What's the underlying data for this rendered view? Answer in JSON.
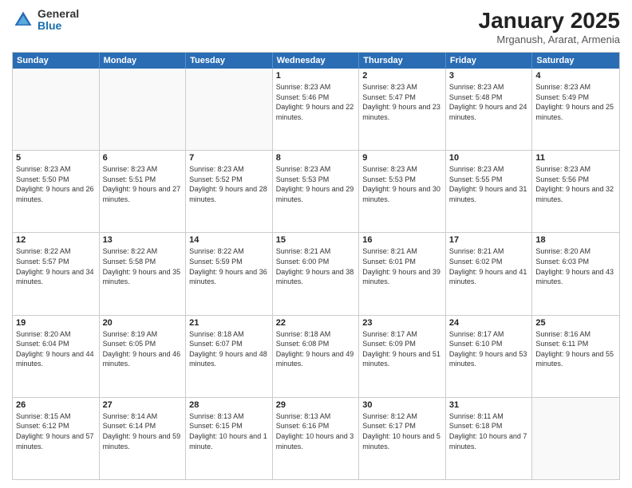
{
  "logo": {
    "general": "General",
    "blue": "Blue"
  },
  "title": "January 2025",
  "subtitle": "Mrganush, Ararat, Armenia",
  "headers": [
    "Sunday",
    "Monday",
    "Tuesday",
    "Wednesday",
    "Thursday",
    "Friday",
    "Saturday"
  ],
  "rows": [
    [
      {
        "day": "",
        "sunrise": "",
        "sunset": "",
        "daylight": "",
        "empty": true
      },
      {
        "day": "",
        "sunrise": "",
        "sunset": "",
        "daylight": "",
        "empty": true
      },
      {
        "day": "",
        "sunrise": "",
        "sunset": "",
        "daylight": "",
        "empty": true
      },
      {
        "day": "1",
        "sunrise": "Sunrise: 8:23 AM",
        "sunset": "Sunset: 5:46 PM",
        "daylight": "Daylight: 9 hours and 22 minutes."
      },
      {
        "day": "2",
        "sunrise": "Sunrise: 8:23 AM",
        "sunset": "Sunset: 5:47 PM",
        "daylight": "Daylight: 9 hours and 23 minutes."
      },
      {
        "day": "3",
        "sunrise": "Sunrise: 8:23 AM",
        "sunset": "Sunset: 5:48 PM",
        "daylight": "Daylight: 9 hours and 24 minutes."
      },
      {
        "day": "4",
        "sunrise": "Sunrise: 8:23 AM",
        "sunset": "Sunset: 5:49 PM",
        "daylight": "Daylight: 9 hours and 25 minutes."
      }
    ],
    [
      {
        "day": "5",
        "sunrise": "Sunrise: 8:23 AM",
        "sunset": "Sunset: 5:50 PM",
        "daylight": "Daylight: 9 hours and 26 minutes."
      },
      {
        "day": "6",
        "sunrise": "Sunrise: 8:23 AM",
        "sunset": "Sunset: 5:51 PM",
        "daylight": "Daylight: 9 hours and 27 minutes."
      },
      {
        "day": "7",
        "sunrise": "Sunrise: 8:23 AM",
        "sunset": "Sunset: 5:52 PM",
        "daylight": "Daylight: 9 hours and 28 minutes."
      },
      {
        "day": "8",
        "sunrise": "Sunrise: 8:23 AM",
        "sunset": "Sunset: 5:53 PM",
        "daylight": "Daylight: 9 hours and 29 minutes."
      },
      {
        "day": "9",
        "sunrise": "Sunrise: 8:23 AM",
        "sunset": "Sunset: 5:53 PM",
        "daylight": "Daylight: 9 hours and 30 minutes."
      },
      {
        "day": "10",
        "sunrise": "Sunrise: 8:23 AM",
        "sunset": "Sunset: 5:55 PM",
        "daylight": "Daylight: 9 hours and 31 minutes."
      },
      {
        "day": "11",
        "sunrise": "Sunrise: 8:23 AM",
        "sunset": "Sunset: 5:56 PM",
        "daylight": "Daylight: 9 hours and 32 minutes."
      }
    ],
    [
      {
        "day": "12",
        "sunrise": "Sunrise: 8:22 AM",
        "sunset": "Sunset: 5:57 PM",
        "daylight": "Daylight: 9 hours and 34 minutes."
      },
      {
        "day": "13",
        "sunrise": "Sunrise: 8:22 AM",
        "sunset": "Sunset: 5:58 PM",
        "daylight": "Daylight: 9 hours and 35 minutes."
      },
      {
        "day": "14",
        "sunrise": "Sunrise: 8:22 AM",
        "sunset": "Sunset: 5:59 PM",
        "daylight": "Daylight: 9 hours and 36 minutes."
      },
      {
        "day": "15",
        "sunrise": "Sunrise: 8:21 AM",
        "sunset": "Sunset: 6:00 PM",
        "daylight": "Daylight: 9 hours and 38 minutes."
      },
      {
        "day": "16",
        "sunrise": "Sunrise: 8:21 AM",
        "sunset": "Sunset: 6:01 PM",
        "daylight": "Daylight: 9 hours and 39 minutes."
      },
      {
        "day": "17",
        "sunrise": "Sunrise: 8:21 AM",
        "sunset": "Sunset: 6:02 PM",
        "daylight": "Daylight: 9 hours and 41 minutes."
      },
      {
        "day": "18",
        "sunrise": "Sunrise: 8:20 AM",
        "sunset": "Sunset: 6:03 PM",
        "daylight": "Daylight: 9 hours and 43 minutes."
      }
    ],
    [
      {
        "day": "19",
        "sunrise": "Sunrise: 8:20 AM",
        "sunset": "Sunset: 6:04 PM",
        "daylight": "Daylight: 9 hours and 44 minutes."
      },
      {
        "day": "20",
        "sunrise": "Sunrise: 8:19 AM",
        "sunset": "Sunset: 6:05 PM",
        "daylight": "Daylight: 9 hours and 46 minutes."
      },
      {
        "day": "21",
        "sunrise": "Sunrise: 8:18 AM",
        "sunset": "Sunset: 6:07 PM",
        "daylight": "Daylight: 9 hours and 48 minutes."
      },
      {
        "day": "22",
        "sunrise": "Sunrise: 8:18 AM",
        "sunset": "Sunset: 6:08 PM",
        "daylight": "Daylight: 9 hours and 49 minutes."
      },
      {
        "day": "23",
        "sunrise": "Sunrise: 8:17 AM",
        "sunset": "Sunset: 6:09 PM",
        "daylight": "Daylight: 9 hours and 51 minutes."
      },
      {
        "day": "24",
        "sunrise": "Sunrise: 8:17 AM",
        "sunset": "Sunset: 6:10 PM",
        "daylight": "Daylight: 9 hours and 53 minutes."
      },
      {
        "day": "25",
        "sunrise": "Sunrise: 8:16 AM",
        "sunset": "Sunset: 6:11 PM",
        "daylight": "Daylight: 9 hours and 55 minutes."
      }
    ],
    [
      {
        "day": "26",
        "sunrise": "Sunrise: 8:15 AM",
        "sunset": "Sunset: 6:12 PM",
        "daylight": "Daylight: 9 hours and 57 minutes."
      },
      {
        "day": "27",
        "sunrise": "Sunrise: 8:14 AM",
        "sunset": "Sunset: 6:14 PM",
        "daylight": "Daylight: 9 hours and 59 minutes."
      },
      {
        "day": "28",
        "sunrise": "Sunrise: 8:13 AM",
        "sunset": "Sunset: 6:15 PM",
        "daylight": "Daylight: 10 hours and 1 minute."
      },
      {
        "day": "29",
        "sunrise": "Sunrise: 8:13 AM",
        "sunset": "Sunset: 6:16 PM",
        "daylight": "Daylight: 10 hours and 3 minutes."
      },
      {
        "day": "30",
        "sunrise": "Sunrise: 8:12 AM",
        "sunset": "Sunset: 6:17 PM",
        "daylight": "Daylight: 10 hours and 5 minutes."
      },
      {
        "day": "31",
        "sunrise": "Sunrise: 8:11 AM",
        "sunset": "Sunset: 6:18 PM",
        "daylight": "Daylight: 10 hours and 7 minutes."
      },
      {
        "day": "",
        "sunrise": "",
        "sunset": "",
        "daylight": "",
        "empty": true
      }
    ]
  ]
}
